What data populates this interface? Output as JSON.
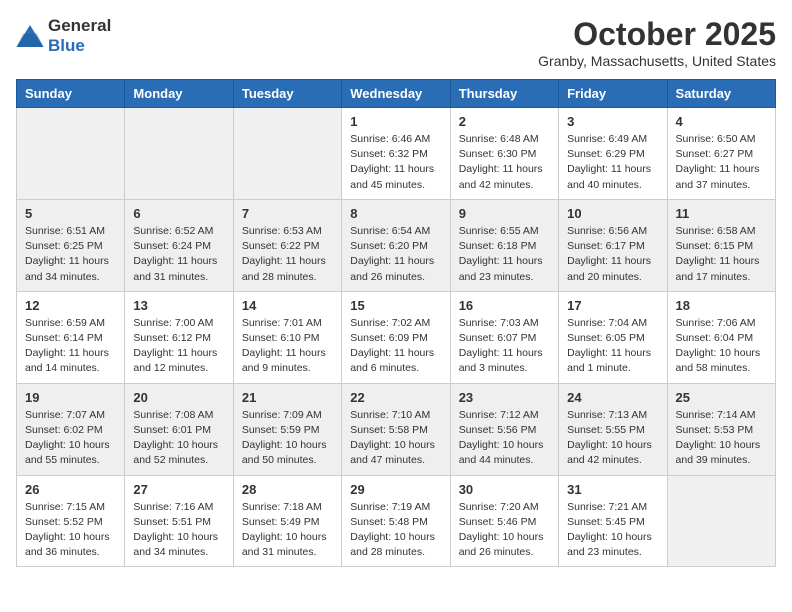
{
  "header": {
    "logo_general": "General",
    "logo_blue": "Blue",
    "month": "October 2025",
    "location": "Granby, Massachusetts, United States"
  },
  "weekdays": [
    "Sunday",
    "Monday",
    "Tuesday",
    "Wednesday",
    "Thursday",
    "Friday",
    "Saturday"
  ],
  "weeks": [
    [
      {
        "day": "",
        "info": ""
      },
      {
        "day": "",
        "info": ""
      },
      {
        "day": "",
        "info": ""
      },
      {
        "day": "1",
        "info": "Sunrise: 6:46 AM\nSunset: 6:32 PM\nDaylight: 11 hours\nand 45 minutes."
      },
      {
        "day": "2",
        "info": "Sunrise: 6:48 AM\nSunset: 6:30 PM\nDaylight: 11 hours\nand 42 minutes."
      },
      {
        "day": "3",
        "info": "Sunrise: 6:49 AM\nSunset: 6:29 PM\nDaylight: 11 hours\nand 40 minutes."
      },
      {
        "day": "4",
        "info": "Sunrise: 6:50 AM\nSunset: 6:27 PM\nDaylight: 11 hours\nand 37 minutes."
      }
    ],
    [
      {
        "day": "5",
        "info": "Sunrise: 6:51 AM\nSunset: 6:25 PM\nDaylight: 11 hours\nand 34 minutes."
      },
      {
        "day": "6",
        "info": "Sunrise: 6:52 AM\nSunset: 6:24 PM\nDaylight: 11 hours\nand 31 minutes."
      },
      {
        "day": "7",
        "info": "Sunrise: 6:53 AM\nSunset: 6:22 PM\nDaylight: 11 hours\nand 28 minutes."
      },
      {
        "day": "8",
        "info": "Sunrise: 6:54 AM\nSunset: 6:20 PM\nDaylight: 11 hours\nand 26 minutes."
      },
      {
        "day": "9",
        "info": "Sunrise: 6:55 AM\nSunset: 6:18 PM\nDaylight: 11 hours\nand 23 minutes."
      },
      {
        "day": "10",
        "info": "Sunrise: 6:56 AM\nSunset: 6:17 PM\nDaylight: 11 hours\nand 20 minutes."
      },
      {
        "day": "11",
        "info": "Sunrise: 6:58 AM\nSunset: 6:15 PM\nDaylight: 11 hours\nand 17 minutes."
      }
    ],
    [
      {
        "day": "12",
        "info": "Sunrise: 6:59 AM\nSunset: 6:14 PM\nDaylight: 11 hours\nand 14 minutes."
      },
      {
        "day": "13",
        "info": "Sunrise: 7:00 AM\nSunset: 6:12 PM\nDaylight: 11 hours\nand 12 minutes."
      },
      {
        "day": "14",
        "info": "Sunrise: 7:01 AM\nSunset: 6:10 PM\nDaylight: 11 hours\nand 9 minutes."
      },
      {
        "day": "15",
        "info": "Sunrise: 7:02 AM\nSunset: 6:09 PM\nDaylight: 11 hours\nand 6 minutes."
      },
      {
        "day": "16",
        "info": "Sunrise: 7:03 AM\nSunset: 6:07 PM\nDaylight: 11 hours\nand 3 minutes."
      },
      {
        "day": "17",
        "info": "Sunrise: 7:04 AM\nSunset: 6:05 PM\nDaylight: 11 hours\nand 1 minute."
      },
      {
        "day": "18",
        "info": "Sunrise: 7:06 AM\nSunset: 6:04 PM\nDaylight: 10 hours\nand 58 minutes."
      }
    ],
    [
      {
        "day": "19",
        "info": "Sunrise: 7:07 AM\nSunset: 6:02 PM\nDaylight: 10 hours\nand 55 minutes."
      },
      {
        "day": "20",
        "info": "Sunrise: 7:08 AM\nSunset: 6:01 PM\nDaylight: 10 hours\nand 52 minutes."
      },
      {
        "day": "21",
        "info": "Sunrise: 7:09 AM\nSunset: 5:59 PM\nDaylight: 10 hours\nand 50 minutes."
      },
      {
        "day": "22",
        "info": "Sunrise: 7:10 AM\nSunset: 5:58 PM\nDaylight: 10 hours\nand 47 minutes."
      },
      {
        "day": "23",
        "info": "Sunrise: 7:12 AM\nSunset: 5:56 PM\nDaylight: 10 hours\nand 44 minutes."
      },
      {
        "day": "24",
        "info": "Sunrise: 7:13 AM\nSunset: 5:55 PM\nDaylight: 10 hours\nand 42 minutes."
      },
      {
        "day": "25",
        "info": "Sunrise: 7:14 AM\nSunset: 5:53 PM\nDaylight: 10 hours\nand 39 minutes."
      }
    ],
    [
      {
        "day": "26",
        "info": "Sunrise: 7:15 AM\nSunset: 5:52 PM\nDaylight: 10 hours\nand 36 minutes."
      },
      {
        "day": "27",
        "info": "Sunrise: 7:16 AM\nSunset: 5:51 PM\nDaylight: 10 hours\nand 34 minutes."
      },
      {
        "day": "28",
        "info": "Sunrise: 7:18 AM\nSunset: 5:49 PM\nDaylight: 10 hours\nand 31 minutes."
      },
      {
        "day": "29",
        "info": "Sunrise: 7:19 AM\nSunset: 5:48 PM\nDaylight: 10 hours\nand 28 minutes."
      },
      {
        "day": "30",
        "info": "Sunrise: 7:20 AM\nSunset: 5:46 PM\nDaylight: 10 hours\nand 26 minutes."
      },
      {
        "day": "31",
        "info": "Sunrise: 7:21 AM\nSunset: 5:45 PM\nDaylight: 10 hours\nand 23 minutes."
      },
      {
        "day": "",
        "info": ""
      }
    ]
  ]
}
